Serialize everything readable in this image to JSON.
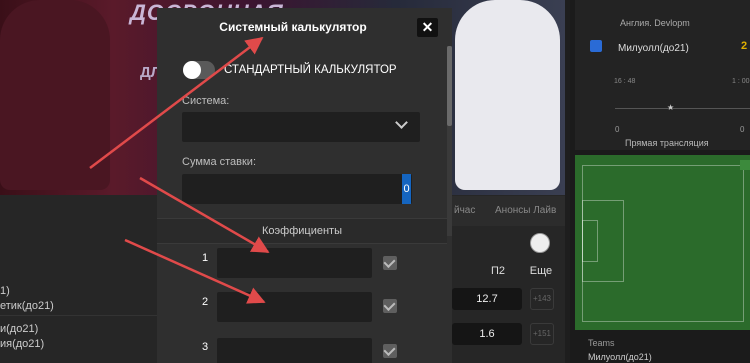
{
  "background": {
    "banner_title": "ДОСРОЧНАЯ",
    "banner_sub": "ДЛ",
    "tab_now": "йчас",
    "tab_live": "Анонсы Лайв",
    "col_p2": "П2",
    "col_more": "Еще",
    "teams": [
      "1)",
      "етик(до21)",
      "и(до21)",
      "ия(до21)"
    ],
    "odds": [
      "12.7",
      "1.6"
    ],
    "more_counts": [
      "+143",
      "+151"
    ]
  },
  "right_panel": {
    "header": "Англия. Devlopm",
    "team": "Милуолл(до21)",
    "score": "2",
    "time_left": "16 : 48",
    "time_right": "1 : 00",
    "zero_left": "0",
    "zero_right": "0",
    "live_label": "Прямая трансляция",
    "teams_label": "Teams",
    "team_bottom": "Милуолл(до21)"
  },
  "modal": {
    "title": "Системный калькулятор",
    "close_glyph": "✕",
    "toggle_label": "СТАНДАРТНЫЙ КАЛЬКУЛЯТОР",
    "system_label": "Система:",
    "system_value": "",
    "stake_label": "Сумма ставки:",
    "stake_value": "0",
    "coef_title": "Коэффициенты",
    "rows": [
      {
        "num": "1",
        "value": "",
        "checked": true
      },
      {
        "num": "2",
        "value": "",
        "checked": true
      },
      {
        "num": "3",
        "value": "",
        "checked": true
      }
    ]
  },
  "annotation_color": "#e04a4a"
}
